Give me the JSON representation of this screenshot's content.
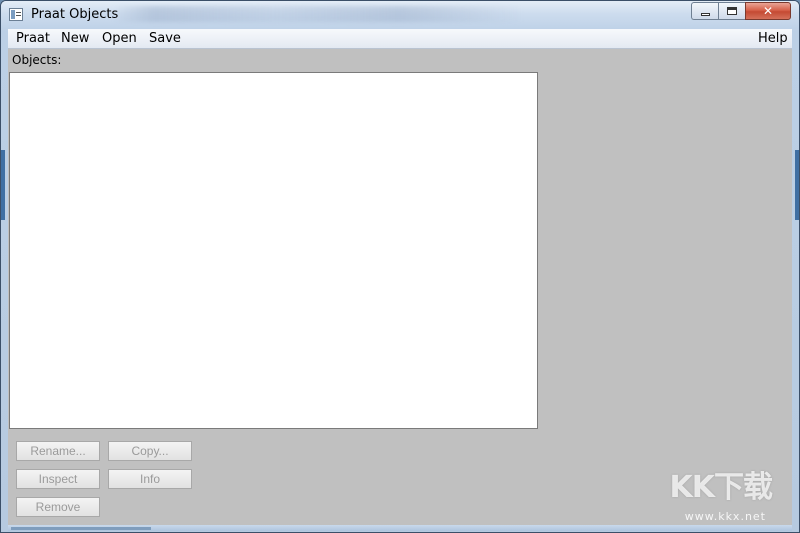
{
  "window": {
    "title": "Praat Objects",
    "close_glyph": "✕"
  },
  "menubar": {
    "items": [
      "Praat",
      "New",
      "Open",
      "Save"
    ],
    "help": "Help"
  },
  "objects": {
    "label": "Objects:"
  },
  "buttons": {
    "rename": "Rename...",
    "copy": "Copy...",
    "inspect": "Inspect",
    "info": "Info",
    "remove": "Remove"
  },
  "watermark": {
    "text": "KK下载",
    "url": "www.kkx.net"
  },
  "colors": {
    "client_bg": "#c0c0c0",
    "list_bg": "#ffffff",
    "disabled_text": "#9a9a9a"
  }
}
